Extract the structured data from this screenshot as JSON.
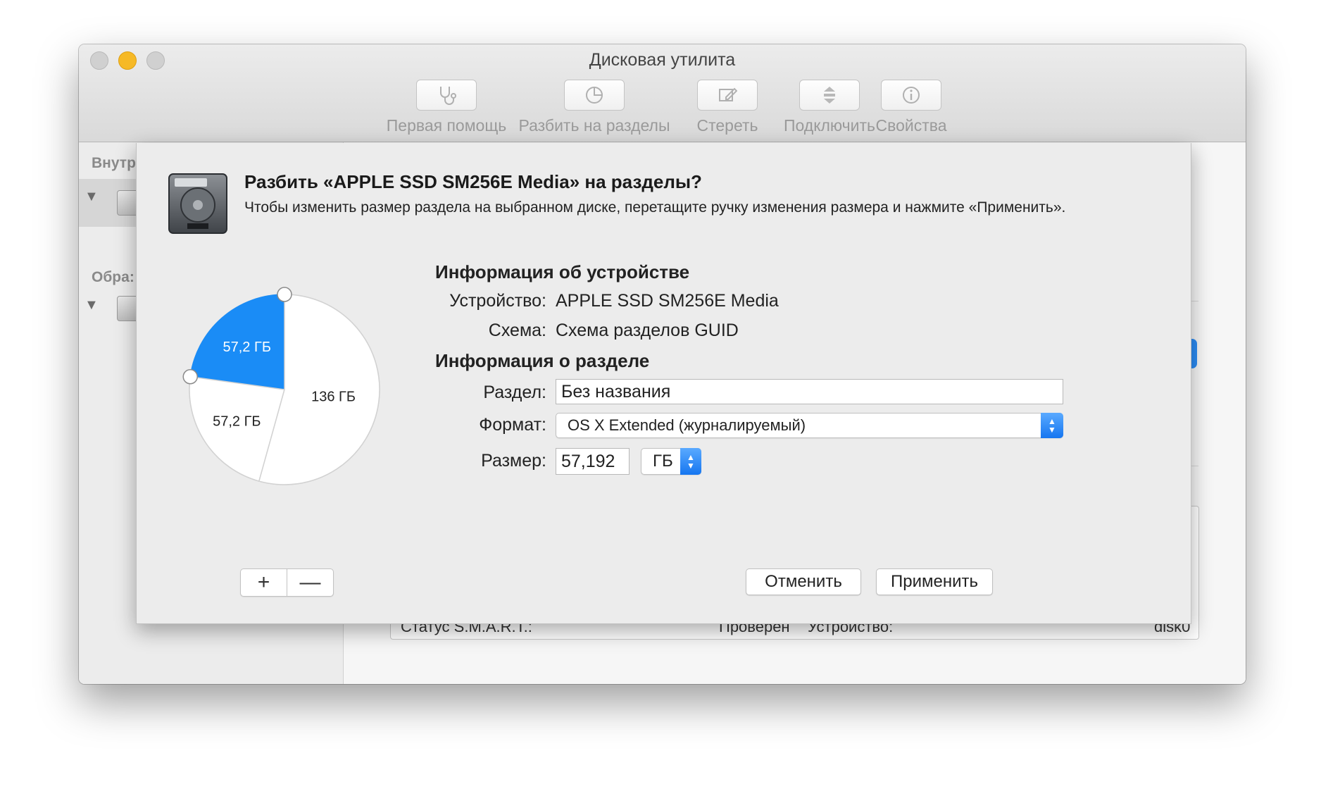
{
  "window": {
    "title": "Дисковая утилита"
  },
  "toolbar": {
    "first_aid": "Первая помощь",
    "partition": "Разбить на разделы",
    "erase": "Стереть",
    "mount": "Подключить",
    "info": "Свойства"
  },
  "sidebar": {
    "internal_heading": "Внутр",
    "images_heading": "Обра:"
  },
  "background_info": {
    "smart_label": "Статус S.M.A.R.T.:",
    "smart_value": "Проверен",
    "device_label": "Устройство:",
    "device_value": "disk0"
  },
  "sheet": {
    "title": "Разбить «APPLE SSD SM256E Media» на разделы?",
    "message": "Чтобы изменить размер раздела на выбранном диске, перетащите ручку изменения размера и нажмите «Применить».",
    "add_label": "+",
    "remove_label": "—",
    "device_info_title": "Информация об устройстве",
    "device_label": "Устройство:",
    "device_value": "APPLE SSD SM256E Media",
    "scheme_label": "Схема:",
    "scheme_value": "Схема разделов GUID",
    "partition_info_title": "Информация о разделе",
    "partition_label": "Раздел:",
    "partition_value": "Без названия",
    "format_label": "Формат:",
    "format_value": "OS X Extended (журналируемый)",
    "size_label": "Размер:",
    "size_value": "57,192",
    "size_unit": "ГБ",
    "cancel_label": "Отменить",
    "apply_label": "Применить"
  },
  "partitions": [
    {
      "label": "57,2 ГБ",
      "selected": true,
      "color": "#1a8cf6"
    },
    {
      "label": "57,2 ГБ",
      "selected": false,
      "color": "#ffffff"
    },
    {
      "label": "136 ГБ",
      "selected": false,
      "color": "#ffffff"
    }
  ],
  "colors": {
    "accent": "#1a8cf6",
    "minimize": "#f6b926"
  }
}
